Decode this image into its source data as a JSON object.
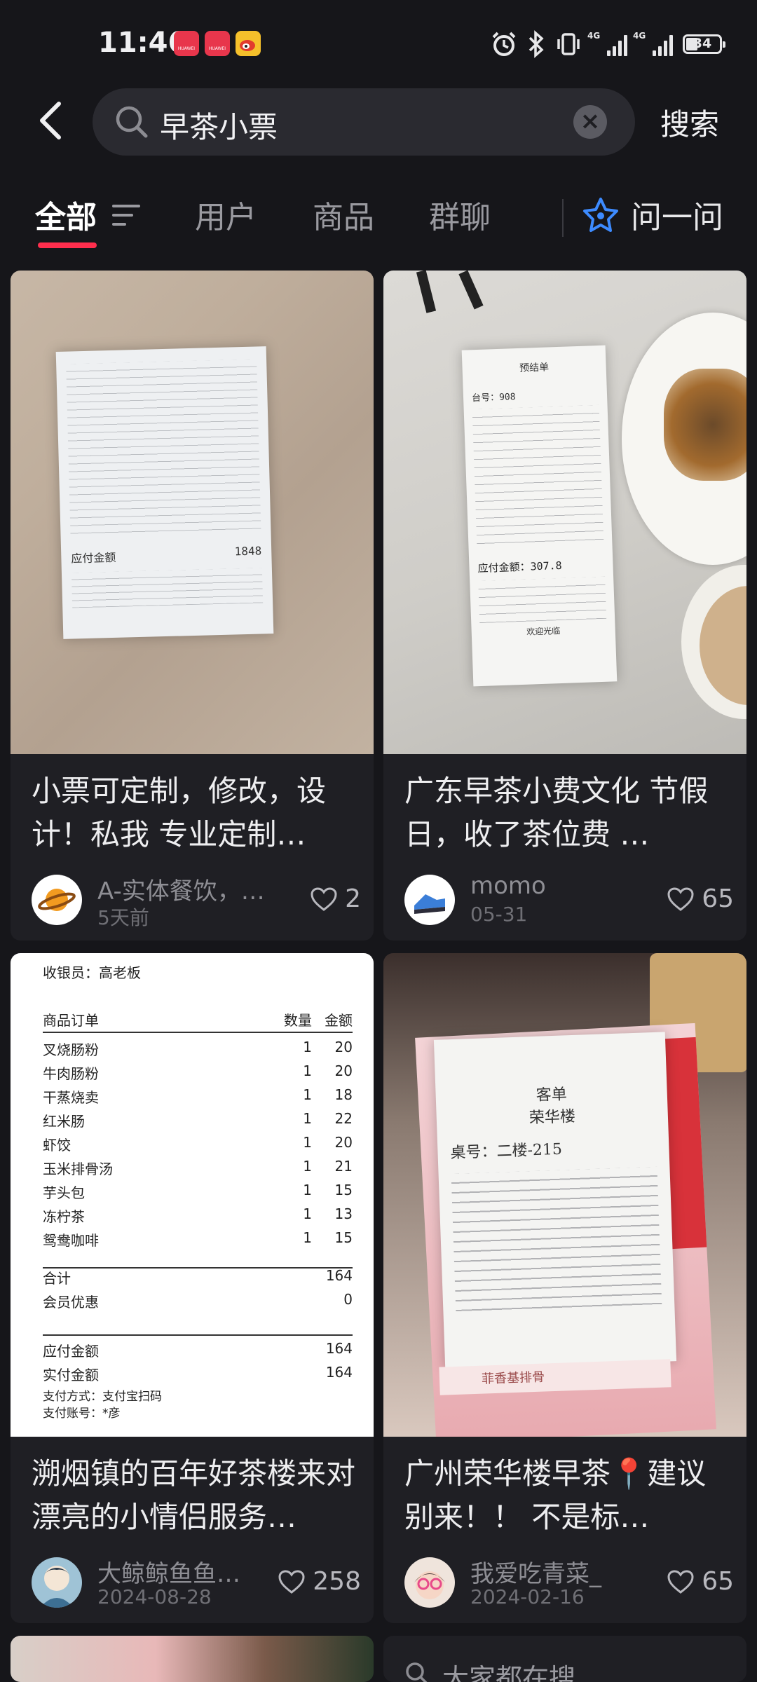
{
  "status": {
    "time": "11:46",
    "battery": "34",
    "network_a": "4G",
    "network_b": "4G"
  },
  "search": {
    "query": "早茶小票",
    "button": "搜索"
  },
  "tabs": [
    {
      "label": "全部"
    },
    {
      "label": "用户"
    },
    {
      "label": "商品"
    },
    {
      "label": "群聊"
    },
    {
      "label": "问一问"
    }
  ],
  "cards": [
    {
      "title": "小票可定制，修改，设计！私我 专业定制…",
      "author": "A-实体餐饮，…",
      "date": "5天前",
      "likes": "2",
      "receipt": {
        "total_label": "应付金额",
        "total": "1848"
      }
    },
    {
      "title": "广东早茶小费文化 节假日，收了茶位费 …",
      "author": "momo",
      "date": "05-31",
      "likes": "65",
      "receipt": {
        "head": "预结单",
        "table": "台号：908",
        "total": "应付金额：307.8",
        "foot": "欢迎光临"
      }
    },
    {
      "title": "溯烟镇的百年好茶楼来对漂亮的小情侣服务…",
      "author": "大鲸鲸鱼鱼…",
      "date": "2024-08-28",
      "likes": "258",
      "receipt": {
        "cashier": "收银员：高老板",
        "headers": {
          "item": "商品订单",
          "qty": "数量",
          "amount": "金额"
        },
        "items": [
          {
            "name": "叉烧肠粉",
            "qty": "1",
            "amount": "20"
          },
          {
            "name": "牛肉肠粉",
            "qty": "1",
            "amount": "20"
          },
          {
            "name": "干蒸烧卖",
            "qty": "1",
            "amount": "18"
          },
          {
            "name": "红米肠",
            "qty": "1",
            "amount": "22"
          },
          {
            "name": "虾饺",
            "qty": "1",
            "amount": "20"
          },
          {
            "name": "玉米排骨汤",
            "qty": "1",
            "amount": "21"
          },
          {
            "name": "芋头包",
            "qty": "1",
            "amount": "15"
          },
          {
            "name": "冻柠茶",
            "qty": "1",
            "amount": "13"
          },
          {
            "name": "鸳鸯咖啡",
            "qty": "1",
            "amount": "15"
          }
        ],
        "sum_label": "合计",
        "sum": "164",
        "discount_label": "会员优惠",
        "discount": "0",
        "due_label": "应付金额",
        "due": "164",
        "paid_label": "实付金额",
        "paid": "164",
        "pay_method": "支付方式：支付宝扫码",
        "pay_account": "支付账号：*彦"
      }
    },
    {
      "title": "广州荣华楼早茶📍建议别来！！ 不是标…",
      "author": "我爱吃青菜_",
      "date": "2024-02-16",
      "likes": "65",
      "receipt": {
        "head1": "客单",
        "head2": "荣华楼",
        "table": "桌号：二楼-215",
        "banner": "菲香基排骨"
      }
    }
  ],
  "peek": {
    "text": "大家都在搜"
  },
  "colors": {
    "accent": "#ff2e4d",
    "background": "#16161a",
    "card": "#1f1f24"
  }
}
